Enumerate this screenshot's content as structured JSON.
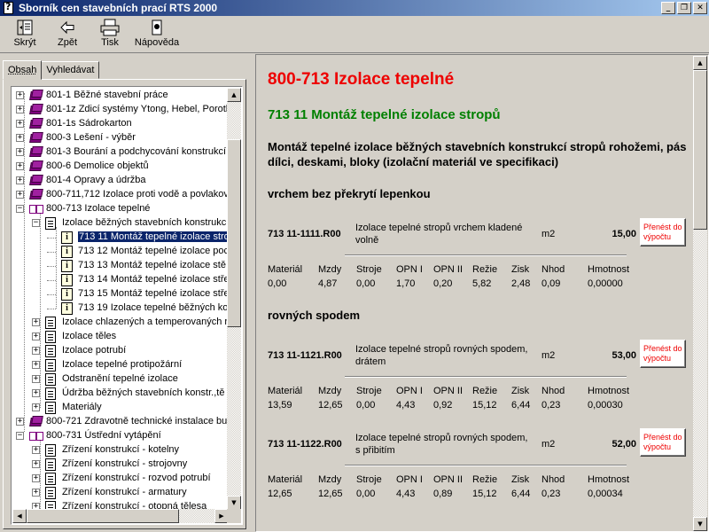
{
  "window": {
    "title": "Sborník cen stavebních prací RTS 2000"
  },
  "toolbar": {
    "hide": "Skrýt",
    "back": "Zpět",
    "print": "Tisk",
    "help": "Nápověda"
  },
  "tabs": {
    "contents": "Obsah",
    "search": "Vyhledávat"
  },
  "tree": [
    {
      "label": "801-1 Běžné stavební práce"
    },
    {
      "label": "801-1z Zdicí systémy Ytong, Hebel, Poroth"
    },
    {
      "label": "801-1s Sádrokarton"
    },
    {
      "label": "800-3 Lešení - výběr"
    },
    {
      "label": "801-3 Bourání a podchycování konstrukcí"
    },
    {
      "label": "800-6 Demolice objektů"
    },
    {
      "label": "801-4 Opravy a údržba"
    },
    {
      "label": "800-711,712 Izolace proti vodě a povlakov"
    },
    {
      "label": "800-713 Izolace tepelné"
    },
    {
      "label": "Izolace běžných stavebních konstrukc"
    },
    {
      "label": "713 11 Montáž tepelné izolace stro"
    },
    {
      "label": "713 12 Montáž tepelné izolace poc"
    },
    {
      "label": "713 13 Montáž tepelné izolace stě"
    },
    {
      "label": "713 14 Montáž tepelné izolace stře"
    },
    {
      "label": "713 15 Montáž tepelné izolace stře"
    },
    {
      "label": "713 19 Izolace tepelné běžných ko"
    },
    {
      "label": "Izolace chlazených a temperovaných r"
    },
    {
      "label": "Izolace těles"
    },
    {
      "label": "Izolace potrubí"
    },
    {
      "label": "Izolace tepelné protipožární"
    },
    {
      "label": "Odstranění tepelné izolace"
    },
    {
      "label": "Údržba běžných stavebních konstr.,tě"
    },
    {
      "label": "Materiály"
    },
    {
      "label": "800-721 Zdravotně technické instalace bu"
    },
    {
      "label": "800-731 Ústřední vytápění"
    },
    {
      "label": "Zřízení konstrukcí - kotelny"
    },
    {
      "label": "Zřízení konstrukcí - strojovny"
    },
    {
      "label": "Zřízení konstrukcí - rozvod potrubí"
    },
    {
      "label": "Zřízení konstrukcí - armatury"
    },
    {
      "label": "Zřízení konstrukcí - otopná tělesa"
    }
  ],
  "content": {
    "heading": "800-713 Izolace tepelné",
    "subheading": "713 11 Montáž tepelné izolace stropů",
    "description_line1": "Montáž tepelné izolace běžných stavebních konstrukcí stropů rohožemi, pás",
    "description_line2": "dílci, deskami, bloky (izolační materiál ve specifikaci)",
    "sections": [
      {
        "title": "vrchem bez překrytí lepenkou"
      },
      {
        "title": "rovných spodem"
      }
    ],
    "calc_button_line1": "Přenést do",
    "calc_button_line2": "výpočtu",
    "columns": [
      "Materiál",
      "Mzdy",
      "Stroje",
      "OPN I",
      "OPN II",
      "Režie",
      "Zisk",
      "Nhod",
      "Hmotnost"
    ],
    "items": [
      {
        "code": "713 11-1111.R00",
        "name": "Izolace tepelné stropů vrchem kladené volně",
        "unit": "m2",
        "price": "15,00",
        "values": [
          "0,00",
          "4,87",
          "0,00",
          "1,70",
          "0,20",
          "5,82",
          "2,48",
          "0,09",
          "0,00000"
        ]
      },
      {
        "code": "713 11-1121.R00",
        "name": "Izolace tepelné stropů rovných spodem, drátem",
        "unit": "m2",
        "price": "53,00",
        "values": [
          "13,59",
          "12,65",
          "0,00",
          "4,43",
          "0,92",
          "15,12",
          "6,44",
          "0,23",
          "0,00030"
        ]
      },
      {
        "code": "713 11-1122.R00",
        "name": "Izolace tepelné stropů rovných spodem, s přibitím",
        "unit": "m2",
        "price": "52,00",
        "values": [
          "12,65",
          "12,65",
          "0,00",
          "4,43",
          "0,89",
          "15,12",
          "6,44",
          "0,23",
          "0,00034"
        ]
      }
    ]
  }
}
